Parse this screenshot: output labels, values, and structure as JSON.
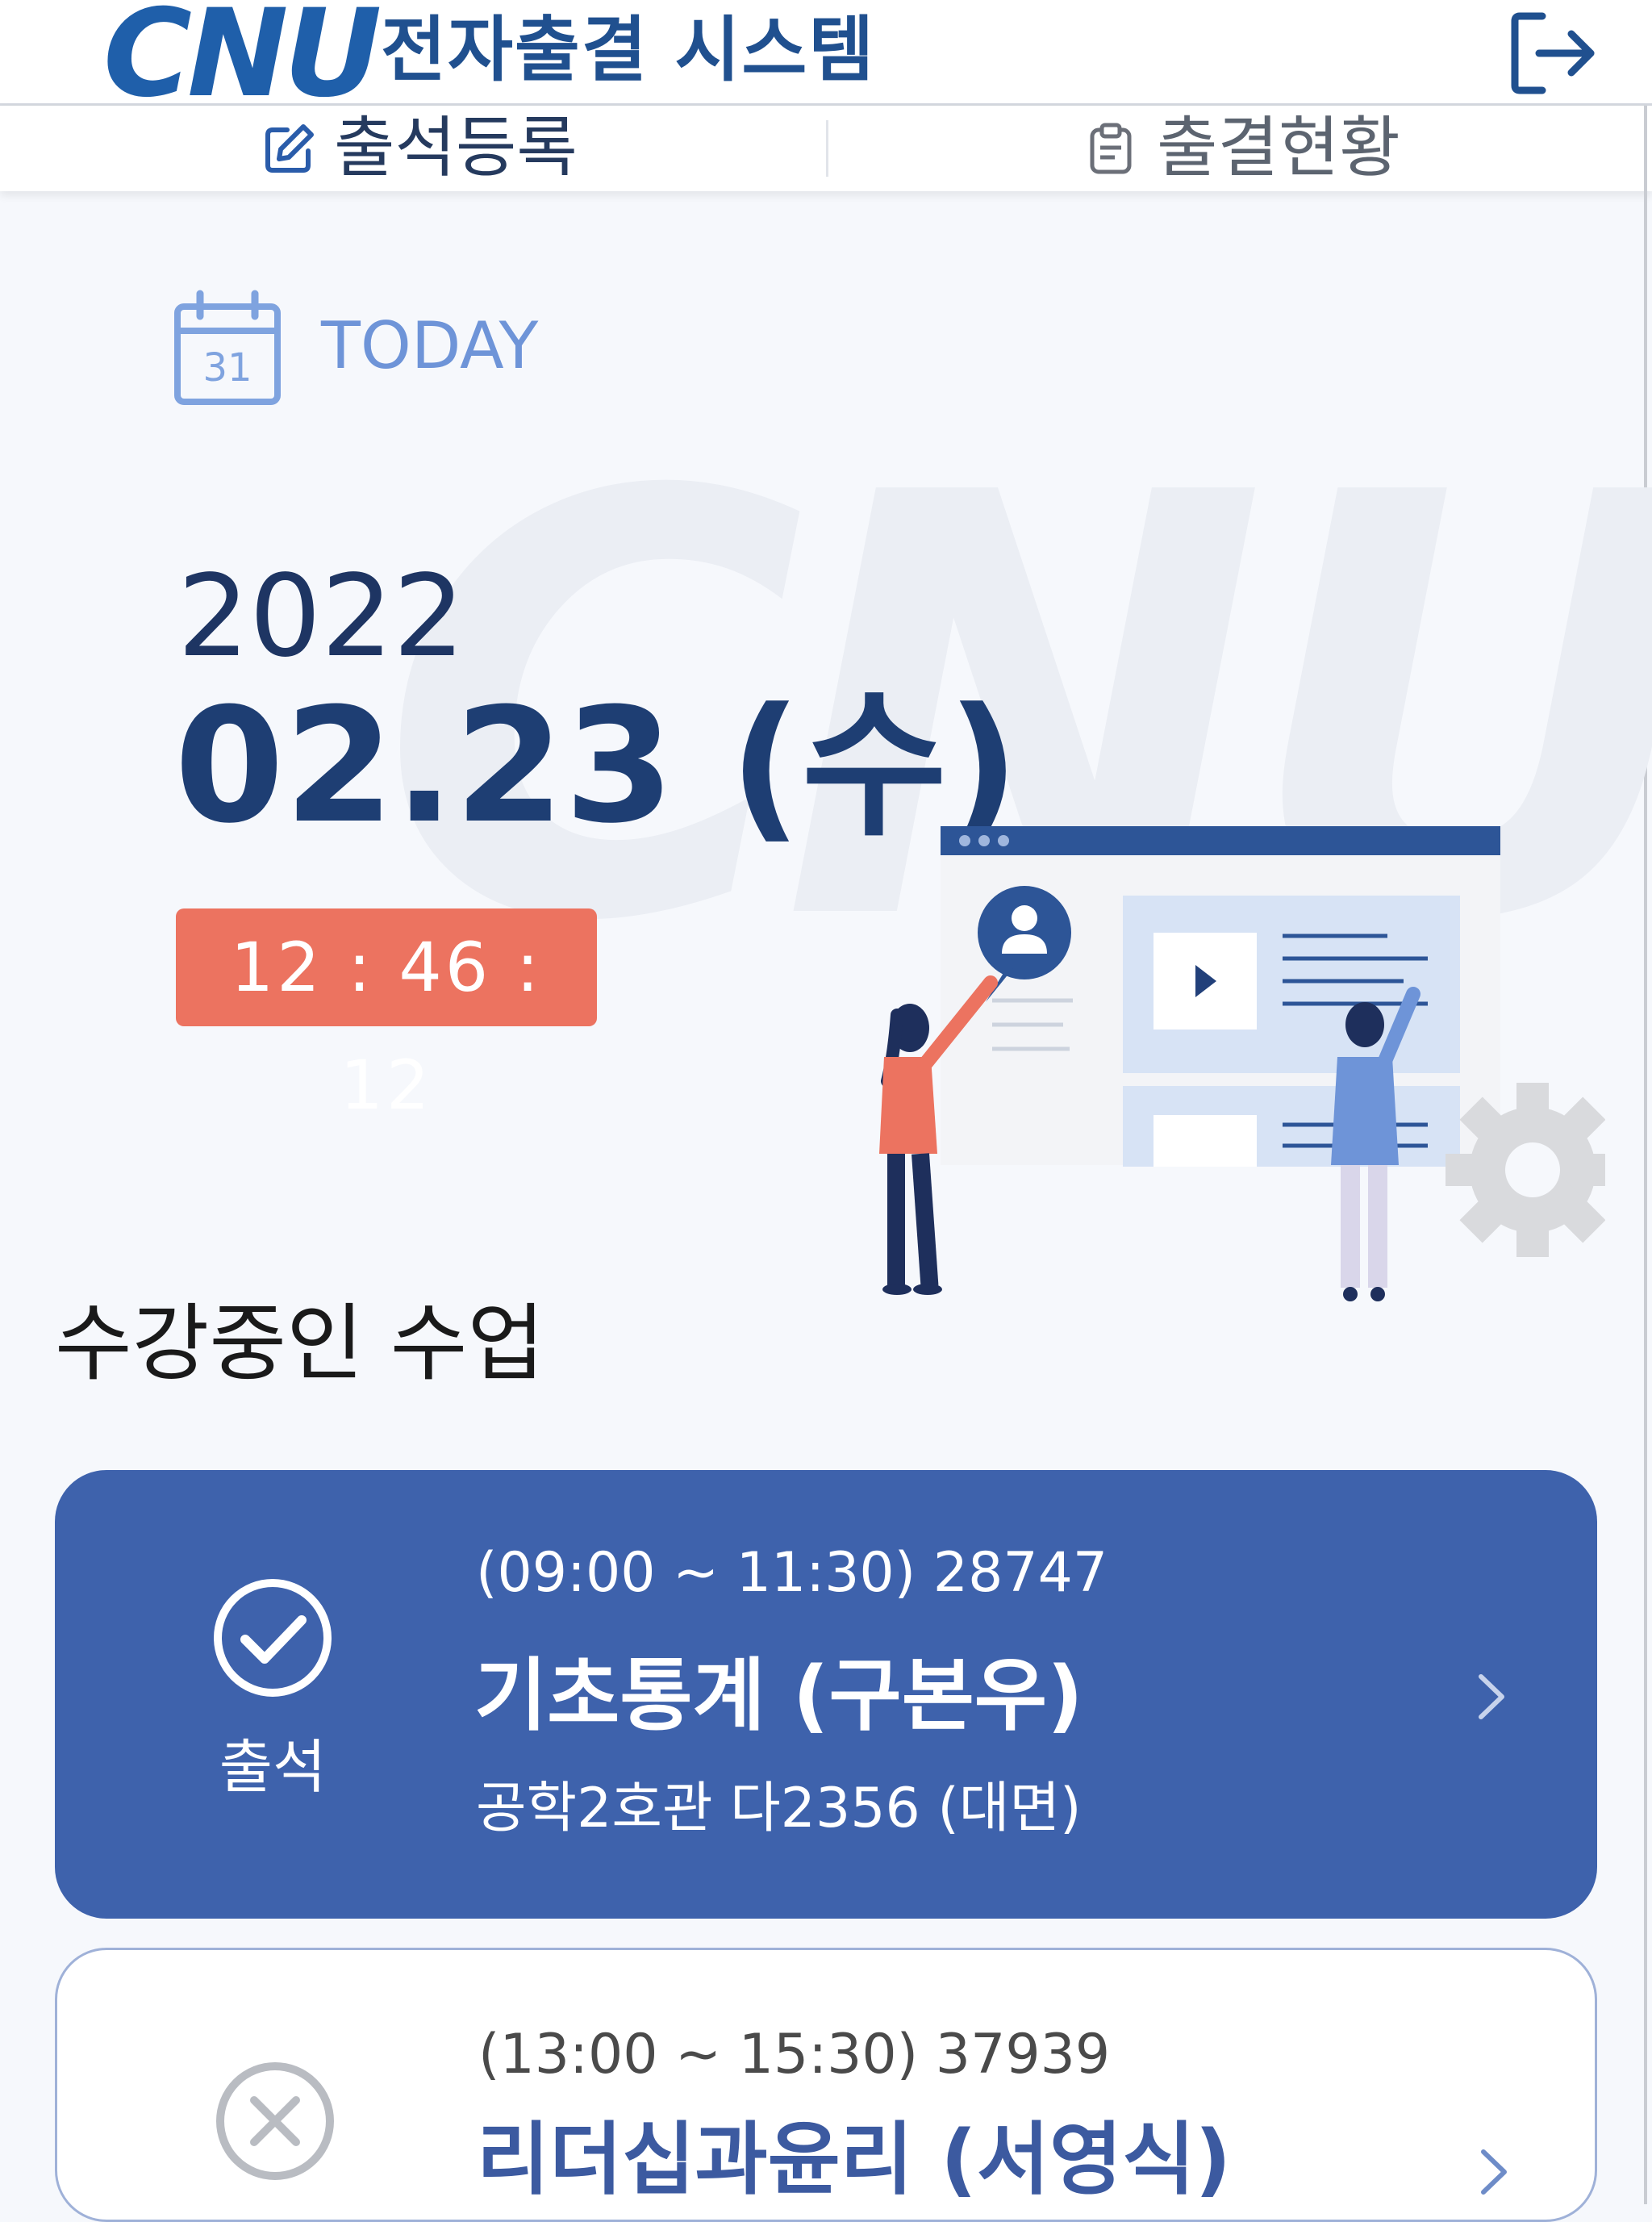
{
  "header": {
    "logo_text": "CNU",
    "title": "전자출결 시스템",
    "logout_icon": "logout-icon"
  },
  "tabs": [
    {
      "label": "출석등록",
      "icon": "edit-icon"
    },
    {
      "label": "출결현황",
      "icon": "clipboard-icon"
    }
  ],
  "today": {
    "label": "TODAY",
    "calendar_day": "31",
    "year": "2022",
    "date": "02.23 (수)",
    "time": "12 : 46 : 12"
  },
  "courses_section": {
    "title": "수강중인 수업",
    "courses": [
      {
        "time_code": "(09:00 ~ 11:30) 28747",
        "title": "기초통계 (구본우)",
        "room": "공학2호관 다2356 (대면)",
        "status": "출석",
        "status_icon": "check-circle-icon"
      },
      {
        "time_code": "(13:00 ~ 15:30) 37939",
        "title": "리더십과윤리 (서영식)",
        "status_icon": "x-circle-icon"
      }
    ]
  },
  "colors": {
    "primary": "#3e62ac",
    "brand_dark": "#1e3e73",
    "clock_bg": "#ec7360",
    "today_accent": "#6e94d8"
  }
}
